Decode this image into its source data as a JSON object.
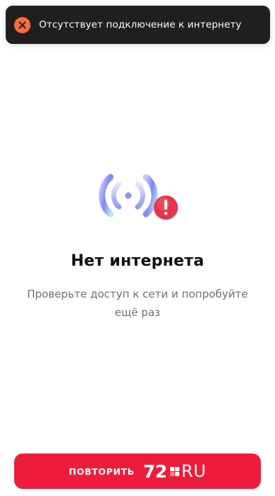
{
  "toast": {
    "icon": "close-circle-icon",
    "message": "Отсутствует подключение к интернету",
    "colors": {
      "background": "#1f1f1f",
      "icon": "#ff6a3d"
    }
  },
  "illustration": {
    "icon": "signal-waves-warning-icon",
    "badge_mark": "!"
  },
  "main": {
    "title": "Нет интернета",
    "subtitle": "Проверьте доступ к сети и попробуйте ещё раз"
  },
  "retry_button": {
    "label": "ПОВТОРИТЬ",
    "color": "#ee1c3b"
  },
  "logo": {
    "number": "72",
    "suffix": "RU"
  }
}
